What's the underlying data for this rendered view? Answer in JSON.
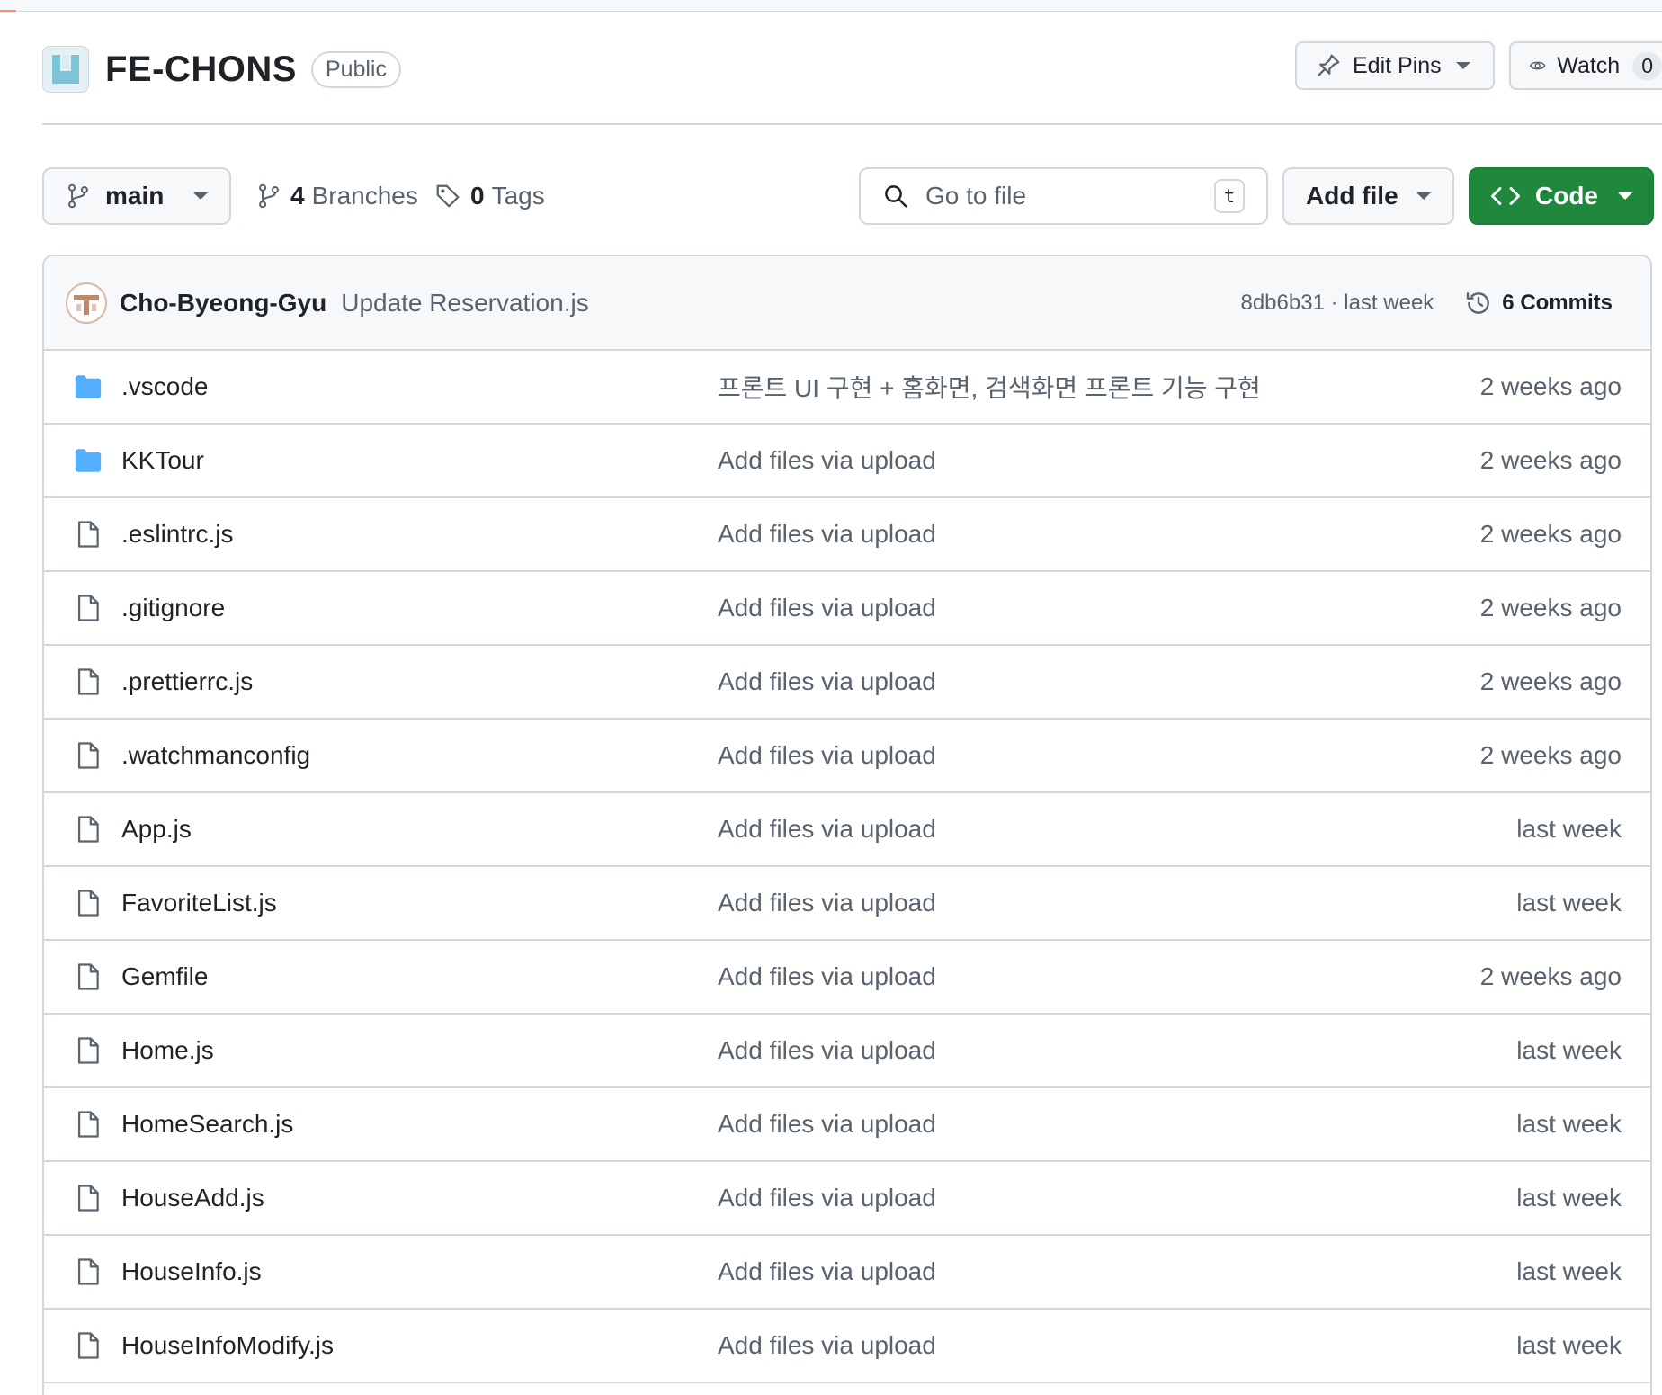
{
  "repo": {
    "name": "FE-CHONS",
    "visibility": "Public",
    "actions": {
      "edit_pins": "Edit Pins",
      "watch": "Watch",
      "watch_count": "0"
    }
  },
  "toolbar": {
    "branch": "main",
    "branches_count": "4",
    "branches_label": "Branches",
    "tags_count": "0",
    "tags_label": "Tags",
    "search_placeholder": "Go to file",
    "search_shortcut": "t",
    "add_file": "Add file",
    "code": "Code"
  },
  "latest_commit": {
    "author": "Cho-Byeong-Gyu",
    "message": "Update Reservation.js",
    "meta": "8db6b31 · last week",
    "commits_label": "6 Commits"
  },
  "files": [
    {
      "type": "folder",
      "name": ".vscode",
      "message": "프론트 UI 구현 + 홈화면, 검색화면 프론트 기능 구현",
      "date": "2 weeks ago"
    },
    {
      "type": "folder",
      "name": "KKTour",
      "message": "Add files via upload",
      "date": "2 weeks ago"
    },
    {
      "type": "file",
      "name": ".eslintrc.js",
      "message": "Add files via upload",
      "date": "2 weeks ago"
    },
    {
      "type": "file",
      "name": ".gitignore",
      "message": "Add files via upload",
      "date": "2 weeks ago"
    },
    {
      "type": "file",
      "name": ".prettierrc.js",
      "message": "Add files via upload",
      "date": "2 weeks ago"
    },
    {
      "type": "file",
      "name": ".watchmanconfig",
      "message": "Add files via upload",
      "date": "2 weeks ago"
    },
    {
      "type": "file",
      "name": "App.js",
      "message": "Add files via upload",
      "date": "last week"
    },
    {
      "type": "file",
      "name": "FavoriteList.js",
      "message": "Add files via upload",
      "date": "last week"
    },
    {
      "type": "file",
      "name": "Gemfile",
      "message": "Add files via upload",
      "date": "2 weeks ago"
    },
    {
      "type": "file",
      "name": "Home.js",
      "message": "Add files via upload",
      "date": "last week"
    },
    {
      "type": "file",
      "name": "HomeSearch.js",
      "message": "Add files via upload",
      "date": "last week"
    },
    {
      "type": "file",
      "name": "HouseAdd.js",
      "message": "Add files via upload",
      "date": "last week"
    },
    {
      "type": "file",
      "name": "HouseInfo.js",
      "message": "Add files via upload",
      "date": "last week"
    },
    {
      "type": "file",
      "name": "HouseInfoModify.js",
      "message": "Add files via upload",
      "date": "last week"
    }
  ],
  "colors": {
    "primary_button": "#1f883d",
    "folder_icon": "#54aeff",
    "border": "#d0d7de",
    "muted_text": "#59636e"
  }
}
